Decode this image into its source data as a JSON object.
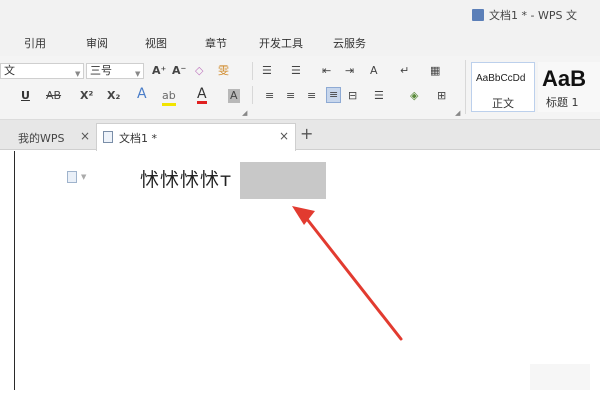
{
  "titlebar": {
    "title": "文档1 * - WPS 文",
    "icon": "document-icon"
  },
  "menu": {
    "items": [
      "引用",
      "审阅",
      "视图",
      "章节",
      "开发工具",
      "云服务"
    ]
  },
  "toolbar": {
    "font_name": "文",
    "font_size": "三号",
    "grow_font": "A⁺",
    "shrink_font": "A⁻",
    "clear_format": "◇",
    "phonetic": "雯",
    "underline": "U",
    "strikethrough": "AB",
    "superscript": "X²",
    "subscript": "X₂",
    "text_effect": "A",
    "highlight": "ab",
    "font_color": "A",
    "char_shading": "A",
    "bullets": "☰",
    "numbering": "☰",
    "indent_decrease": "⇤",
    "indent_increase": "⇥",
    "chinese_layout": "A",
    "show_marks": "↵",
    "table_icon": "▦",
    "align_left": "≡",
    "align_center": "≡",
    "align_right": "≡",
    "justify": "≡",
    "distribute": "⊟",
    "line_spacing": "☰",
    "shading": "◈",
    "borders": "⊞",
    "accent_color": "#d9342b"
  },
  "styles": {
    "normal_sample": "AaBbCcDd",
    "normal_label": "正文",
    "heading1_sample": "AaB",
    "heading1_label": "标题 1"
  },
  "tabs": {
    "mywps_label": "我的WPS",
    "doc_label": "文档1 *",
    "close_glyph": "×",
    "add_glyph": "+"
  },
  "document": {
    "text": "怵怵怵怵т",
    "arrow_color": "#e23b30"
  }
}
